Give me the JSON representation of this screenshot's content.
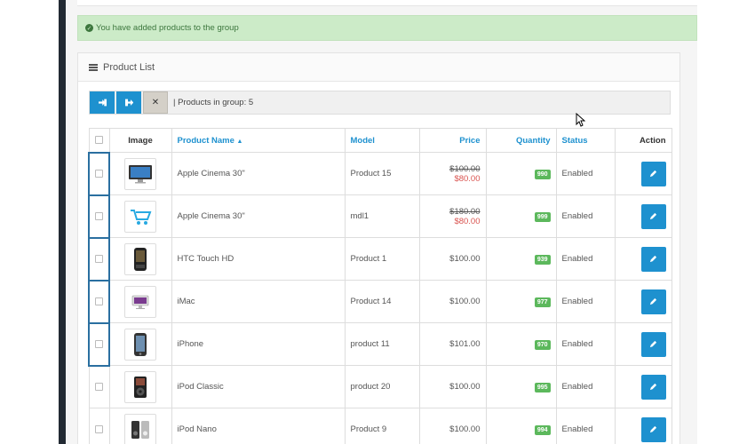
{
  "alert": {
    "message": "You have added products to the group"
  },
  "panel": {
    "title": "Product List"
  },
  "toolbar": {
    "info": "| Products in group: 5"
  },
  "table": {
    "headers": {
      "image": "Image",
      "name": "Product Name",
      "model": "Model",
      "price": "Price",
      "quantity": "Quantity",
      "status": "Status",
      "action": "Action"
    },
    "rows": [
      {
        "name": "Apple Cinema 30\"",
        "model": "Product 15",
        "price": "$100.00",
        "special": "$80.00",
        "quantity": "990",
        "status": "Enabled"
      },
      {
        "name": "Apple Cinema 30\"",
        "model": "mdl1",
        "price": "$180.00",
        "special": "$80.00",
        "quantity": "999",
        "status": "Enabled"
      },
      {
        "name": "HTC Touch HD",
        "model": "Product 1",
        "price": "$100.00",
        "quantity": "939",
        "status": "Enabled"
      },
      {
        "name": "iMac",
        "model": "Product 14",
        "price": "$100.00",
        "quantity": "977",
        "status": "Enabled"
      },
      {
        "name": "iPhone",
        "model": "product 11",
        "price": "$101.00",
        "quantity": "970",
        "status": "Enabled"
      },
      {
        "name": "iPod Classic",
        "model": "product 20",
        "price": "$100.00",
        "quantity": "995",
        "status": "Enabled"
      },
      {
        "name": "iPod Nano",
        "model": "Product 9",
        "price": "$100.00",
        "quantity": "994",
        "status": "Enabled"
      }
    ]
  },
  "colors": {
    "primary": "#1e91cf",
    "success": "#5cb85c",
    "alert_bg": "#ccebc8",
    "special_price": "#d9534f"
  }
}
